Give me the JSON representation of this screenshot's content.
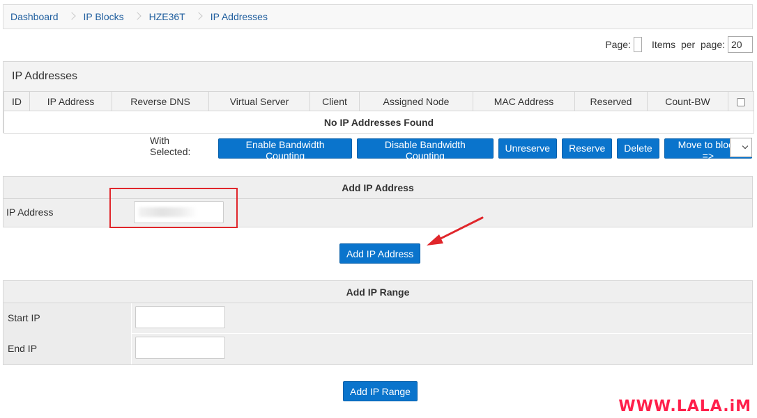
{
  "breadcrumb": {
    "items": [
      "Dashboard",
      "IP Blocks",
      "HZE36T",
      "IP Addresses"
    ]
  },
  "pager": {
    "page_label": "Page:",
    "items_per_page_label": "Items  per  page:",
    "items_per_page_value": "20"
  },
  "ip_table": {
    "title": "IP Addresses",
    "columns": [
      "ID",
      "IP Address",
      "Reverse DNS",
      "Virtual Server",
      "Client",
      "Assigned Node",
      "MAC Address",
      "Reserved",
      "Count-BW"
    ],
    "empty_message": "No IP Addresses Found"
  },
  "bulk_actions": {
    "label": "With Selected:",
    "buttons": [
      "Enable Bandwidth Counting",
      "Disable Bandwidth Counting",
      "Unreserve",
      "Reserve",
      "Delete",
      "Move to block =>"
    ]
  },
  "add_ip": {
    "title": "Add IP Address",
    "field_label": "IP Address",
    "button_label": "Add IP Address"
  },
  "add_range": {
    "title": "Add IP Range",
    "start_label": "Start IP",
    "end_label": "End IP",
    "button_label": "Add IP Range"
  },
  "watermark": "WWW.LALA.iM",
  "colors": {
    "primary_button": "#0a74cc",
    "link": "#1f5e9e",
    "highlight": "#e0262b",
    "watermark": "#ff1f4b"
  }
}
